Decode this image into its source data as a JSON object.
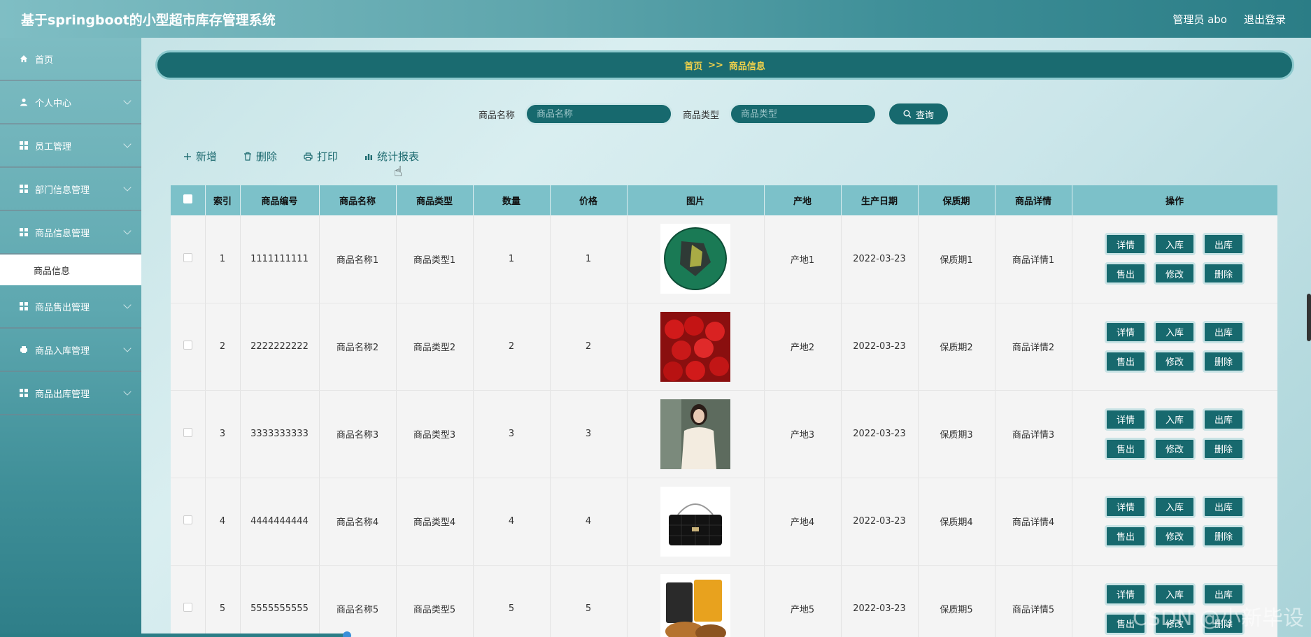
{
  "header": {
    "title": "基于springboot的小型超市库存管理系统",
    "user": "管理员 abo",
    "logout": "退出登录"
  },
  "sidebar": {
    "items": [
      {
        "label": "首页",
        "icon": "home-icon"
      },
      {
        "label": "个人中心",
        "icon": "user-icon"
      },
      {
        "label": "员工管理",
        "icon": "grid-icon"
      },
      {
        "label": "部门信息管理",
        "icon": "grid-icon"
      },
      {
        "label": "商品信息管理",
        "icon": "grid-icon"
      },
      {
        "label": "商品售出管理",
        "icon": "grid-icon"
      },
      {
        "label": "商品入库管理",
        "icon": "print-icon"
      },
      {
        "label": "商品出库管理",
        "icon": "grid-icon"
      }
    ],
    "sub_active": "商品信息"
  },
  "breadcrumb": {
    "home": "首页",
    "sep": ">>",
    "current": "商品信息"
  },
  "search": {
    "name_label": "商品名称",
    "name_placeholder": "商品名称",
    "type_label": "商品类型",
    "type_placeholder": "商品类型",
    "query": "查询"
  },
  "toolbar": {
    "add": "新增",
    "delete": "删除",
    "print": "打印",
    "report": "统计报表"
  },
  "table": {
    "headers": [
      "索引",
      "商品编号",
      "商品名称",
      "商品类型",
      "数量",
      "价格",
      "图片",
      "产地",
      "生产日期",
      "保质期",
      "商品详情",
      "操作"
    ],
    "rows": [
      {
        "idx": "1",
        "code": "1111111111",
        "name": "商品名称1",
        "type": "商品类型1",
        "qty": "1",
        "price": "1",
        "origin": "产地1",
        "date": "2022-03-23",
        "shelf": "保质期1",
        "detail": "商品详情1"
      },
      {
        "idx": "2",
        "code": "2222222222",
        "name": "商品名称2",
        "type": "商品类型2",
        "qty": "2",
        "price": "2",
        "origin": "产地2",
        "date": "2022-03-23",
        "shelf": "保质期2",
        "detail": "商品详情2"
      },
      {
        "idx": "3",
        "code": "3333333333",
        "name": "商品名称3",
        "type": "商品类型3",
        "qty": "3",
        "price": "3",
        "origin": "产地3",
        "date": "2022-03-23",
        "shelf": "保质期3",
        "detail": "商品详情3"
      },
      {
        "idx": "4",
        "code": "4444444444",
        "name": "商品名称4",
        "type": "商品类型4",
        "qty": "4",
        "price": "4",
        "origin": "产地4",
        "date": "2022-03-23",
        "shelf": "保质期4",
        "detail": "商品详情4"
      },
      {
        "idx": "5",
        "code": "5555555555",
        "name": "商品名称5",
        "type": "商品类型5",
        "qty": "5",
        "price": "5",
        "origin": "产地5",
        "date": "2022-03-23",
        "shelf": "保质期5",
        "detail": "商品详情5"
      }
    ],
    "ops": [
      "详情",
      "入库",
      "出库",
      "售出",
      "修改",
      "删除"
    ]
  },
  "watermark": "CSDN @小新毕设"
}
